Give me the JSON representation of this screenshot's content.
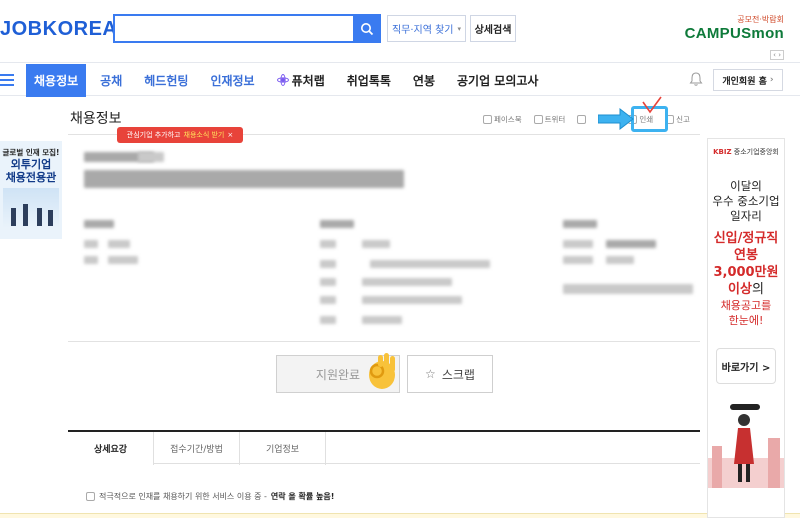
{
  "header": {
    "logo": "JOBKOREA",
    "search_placeholder": "",
    "filter_label": "직무·지역 찾기",
    "advanced_search_label": "상세검색",
    "campus_tag": "공모전·박람회",
    "campus_brand": "CAMPUSmon"
  },
  "nav": {
    "items": [
      "채용정보",
      "공채",
      "헤드헌팅",
      "인재정보",
      "퓨처랩",
      "취업톡톡",
      "연봉",
      "공기업 모의고사"
    ],
    "member_label": "개인회원 홈"
  },
  "left_ad": {
    "line1": "글로벌 인재 모집!",
    "line2": "외투기업",
    "line3": "채용전용관"
  },
  "page": {
    "title": "채용정보",
    "share": {
      "facebook": "페이스북",
      "twitter": "트위터",
      "print": "인쇄",
      "report": "신고"
    },
    "tip_prefix": "관심기업 추가하고",
    "tip_highlight": "채용소식 받기",
    "tip_close": "×"
  },
  "actions": {
    "apply_label": "지원완료",
    "scrap_label": "스크랩"
  },
  "tabs": [
    "상세요강",
    "접수기간/방법",
    "기업정보"
  ],
  "notice": {
    "text": "적극적으로 인재를 채용하기 위한 서비스 이용 중 -",
    "emphasis": "연락 올 확률 높음!"
  },
  "right_ad": {
    "org": "KBIZ",
    "org_suffix": "중소기업중앙회",
    "line1": "이달의",
    "line2": "우수 중소기업",
    "line3": "일자리",
    "line4": "신입/정규직",
    "line5": "연봉",
    "line6": "3,000만원",
    "line7a": "이상",
    "line7b": "의",
    "line8": "채용공고를",
    "line9": "한눈에!",
    "button": "바로가기 >"
  },
  "colors": {
    "brand_blue": "#3a7bf0",
    "accent_red": "#e8433a",
    "highlight_cyan": "#3db2f0"
  }
}
